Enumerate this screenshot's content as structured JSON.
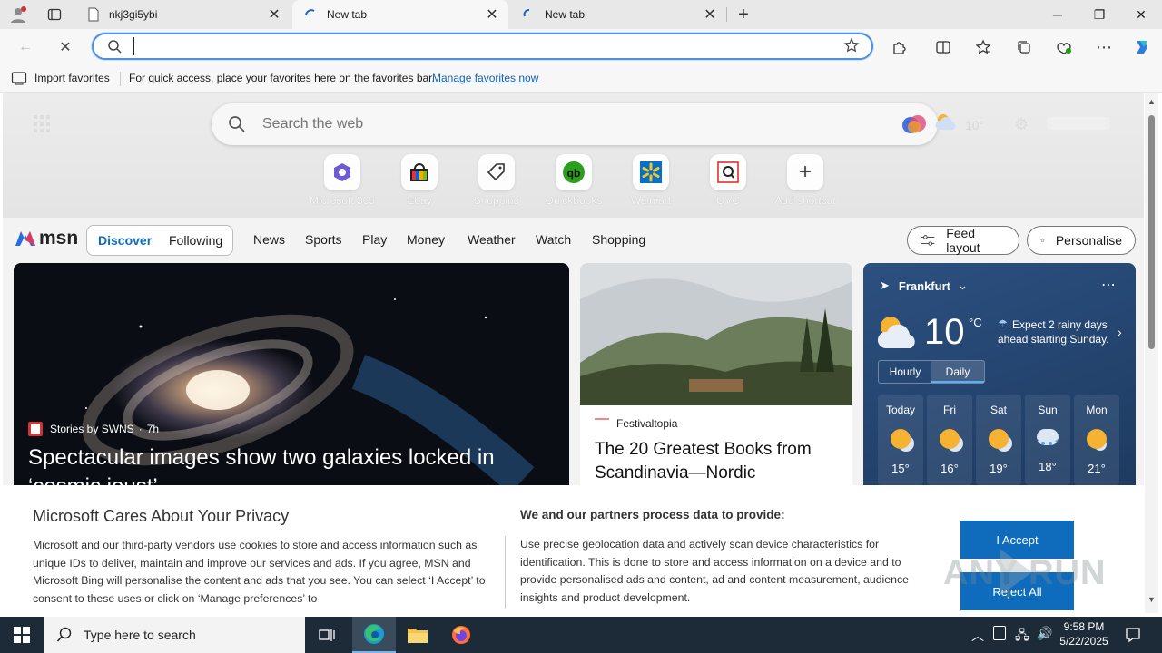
{
  "browser": {
    "tabs": [
      {
        "title": "nkj3gi5ybi",
        "active": false
      },
      {
        "title": "New tab",
        "active": true
      },
      {
        "title": "New tab",
        "active": false
      }
    ],
    "address": {
      "value": "",
      "placeholder": ""
    },
    "favorites_bar": {
      "import_label": "Import favorites",
      "message": "For quick access, place your favorites here on the favorites bar.",
      "manage_link": "Manage favorites now"
    }
  },
  "newtab": {
    "search_placeholder": "Search the web",
    "weather_temp_faint": "10°",
    "shortcuts": [
      {
        "label": "Microsoft 365",
        "icon": "microsoft365-icon"
      },
      {
        "label": "Ebay",
        "icon": "ebay-icon"
      },
      {
        "label": "Shopping",
        "icon": "shopping-tag-icon"
      },
      {
        "label": "Quickbooks",
        "icon": "quickbooks-icon"
      },
      {
        "label": "Walmart",
        "icon": "walmart-icon"
      },
      {
        "label": "QVC",
        "icon": "qvc-icon"
      },
      {
        "label": "Add shortcut",
        "icon": "plus-icon"
      }
    ],
    "msn": {
      "logo": "msn",
      "toggle": [
        "Discover",
        "Following"
      ],
      "nav": [
        "News",
        "Sports",
        "Play",
        "Money",
        "Weather",
        "Watch",
        "Shopping"
      ],
      "feed_layout": "Feed layout",
      "personalise": "Personalise"
    },
    "main_story": {
      "source": "Stories by SWNS",
      "age": "7h",
      "headline": "Spectacular images show two galaxies locked in ‘cosmic joust’"
    },
    "second_story": {
      "source": "Festivaltopia",
      "headline": "The 20 Greatest Books from Scandinavia—Nordic"
    },
    "weather": {
      "location": "Frankfurt",
      "temp": "10",
      "unit": "°C",
      "summary": "Expect 2 rainy days ahead starting Sunday.",
      "tabs": [
        "Hourly",
        "Daily"
      ],
      "days": [
        {
          "name": "Today",
          "high": "15°"
        },
        {
          "name": "Fri",
          "high": "16°"
        },
        {
          "name": "Sat",
          "high": "19°"
        },
        {
          "name": "Sun",
          "high": "18°"
        },
        {
          "name": "Mon",
          "high": "21°"
        }
      ]
    }
  },
  "privacy": {
    "title": "Microsoft Cares About Your Privacy",
    "body": "Microsoft and our third-party vendors use cookies to store and access information such as unique IDs to deliver, maintain and improve our services and ads. If you agree, MSN and Microsoft Bing will personalise the content and ads that you see. You can select ‘I Accept’ to consent to these uses or click on ‘Manage preferences’ to",
    "partners_title": "We and our partners process data to provide:",
    "partners_body": "Use precise geolocation data and actively scan device characteristics for identification. This is done to store and access information on a device and to provide personalised ads and content, ad and content measurement, audience insights and product development.",
    "accept": "I Accept",
    "reject": "Reject All",
    "watermark": "ANY RUN"
  },
  "taskbar": {
    "search_placeholder": "Type here to search",
    "time": "9:58 PM",
    "date": "5/22/2025"
  },
  "colors": {
    "accent": "#0f6cbd",
    "taskbar": "#1d2b38",
    "weather_bg": "#25466f"
  }
}
